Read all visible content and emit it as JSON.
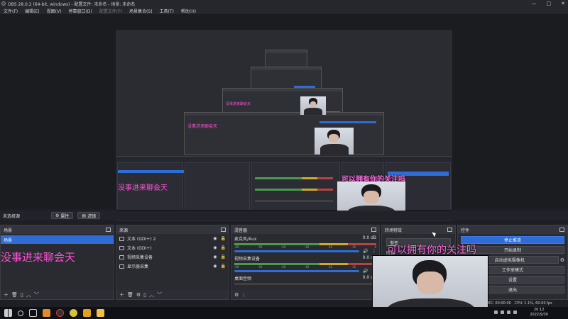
{
  "window": {
    "title": "OBS 28.0.2 (64-bit, windows) - 配置文件: 未命名 - 场景: 未命名"
  },
  "menu": [
    "文件(F)",
    "编辑(E)",
    "视图(V)",
    "停靠窗口(D)",
    "配置文件(P)",
    "场景集合(S)",
    "工具(T)",
    "帮助(H)"
  ],
  "preview": {
    "nested_texts": [
      "没事进来聊会天",
      "没事进来聊会天",
      "没事进来聊会天"
    ],
    "overlay_text": "可以拥有你的关注吗"
  },
  "scenebar": {
    "label": "未选择源",
    "properties": "属性",
    "filters": "滤镜"
  },
  "docks": {
    "scenes": {
      "title": "场景",
      "item": "场景",
      "overlay_text": "没事进来聊会天"
    },
    "sources": {
      "title": "来源",
      "items": [
        {
          "icon": "text-icon",
          "name": "文本 (GDI+) 2"
        },
        {
          "icon": "text-icon",
          "name": "文本 (GDI+)"
        },
        {
          "icon": "camera-icon",
          "name": "视频采集设备"
        },
        {
          "icon": "monitor-icon",
          "name": "显示器采集"
        }
      ]
    },
    "mixer": {
      "title": "混音器",
      "channels": [
        {
          "name": "麦克风/Aux",
          "db": "0.0 dB"
        },
        {
          "name": "视频采集设备",
          "db": "0.0 dB"
        },
        {
          "name": "桌面音频",
          "db": "0.0 dB"
        }
      ],
      "ticks": [
        "-60",
        "-55",
        "-50",
        "-45",
        "-40",
        "-35",
        "-30",
        "-25",
        "-20",
        "-15",
        "-10",
        "-5",
        "0"
      ]
    },
    "transitions": {
      "title": "转场特效",
      "selected": "渐变",
      "duration_label": "时长"
    },
    "controls": {
      "title": "控件",
      "buttons": [
        "停止推流",
        "开始录制",
        "启动虚拟摄像机",
        "工作室模式",
        "设置",
        "退出"
      ]
    }
  },
  "webcam_overlay_text": "可以拥有你的关注吗",
  "status": {
    "rec": "REC: 00:00:00",
    "cpu": "CPU: 1.1%, 60.00 fps"
  },
  "clock": {
    "time": "20:12",
    "date": "2022/9/30"
  }
}
